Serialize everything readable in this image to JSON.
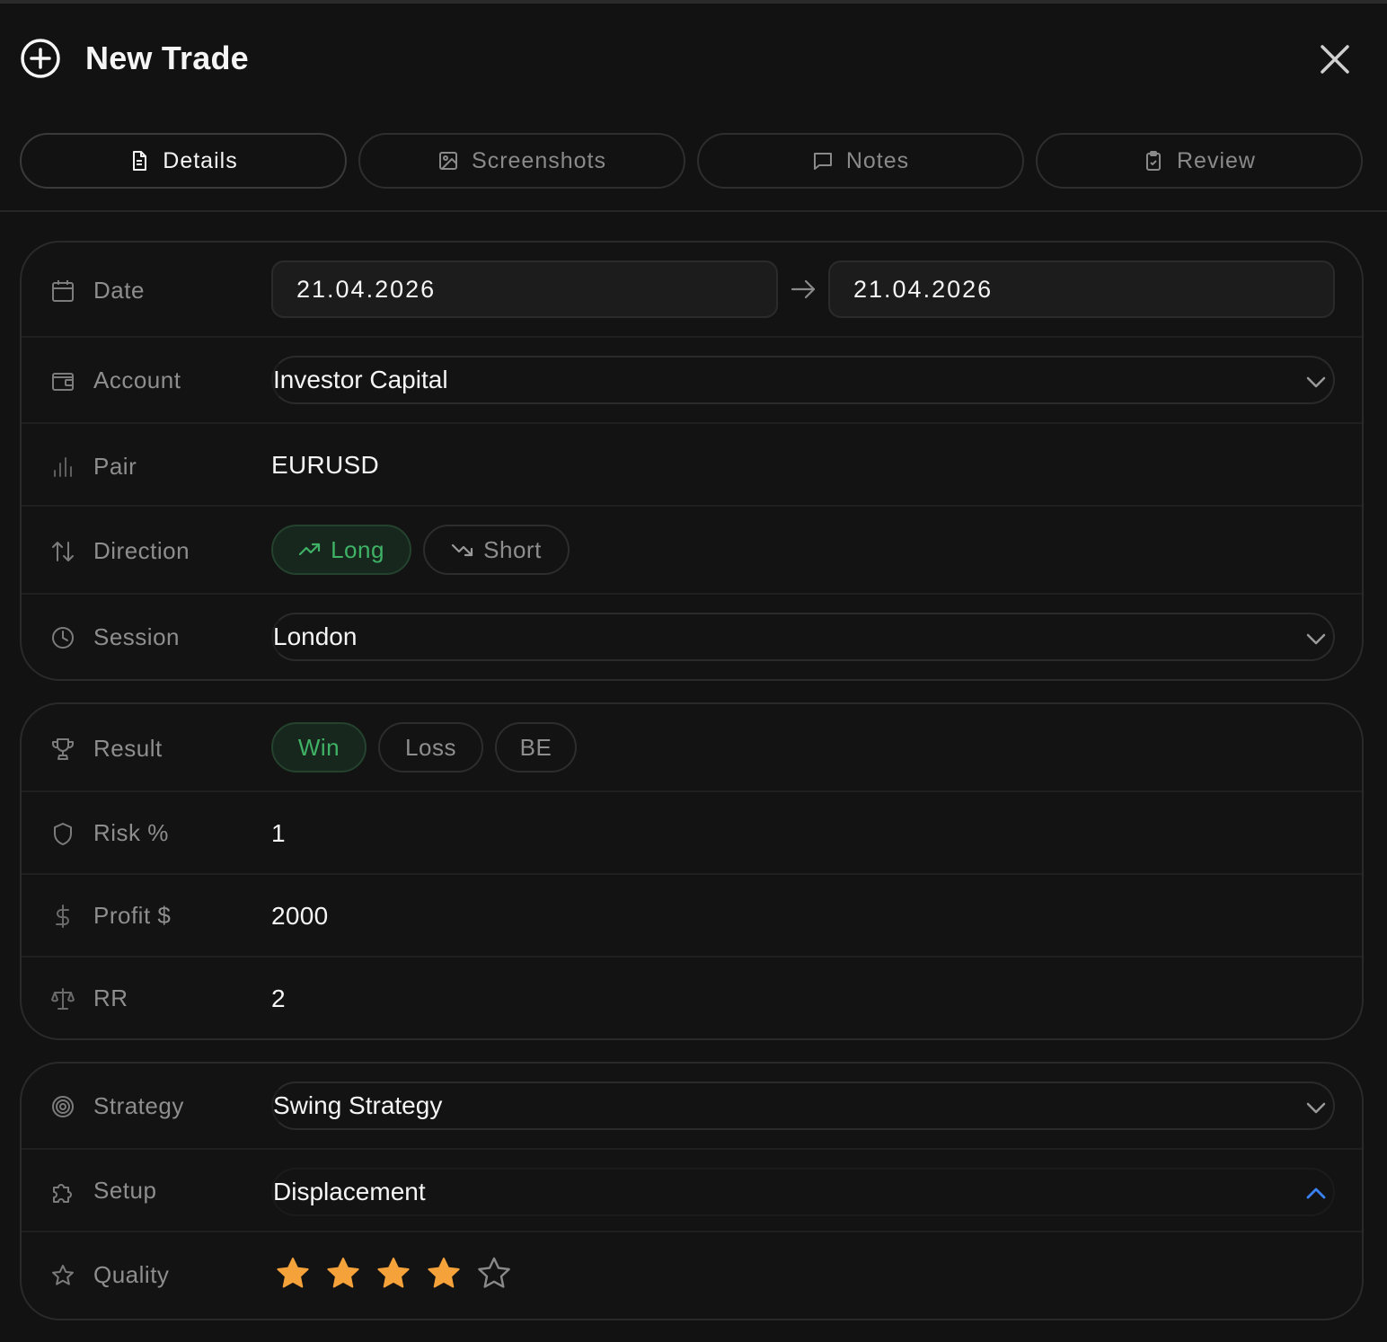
{
  "header": {
    "title": "New Trade"
  },
  "tabs": [
    {
      "label": "Details",
      "icon": "document-icon",
      "active": true
    },
    {
      "label": "Screenshots",
      "icon": "image-icon",
      "active": false
    },
    {
      "label": "Notes",
      "icon": "message-icon",
      "active": false
    },
    {
      "label": "Review",
      "icon": "clipboard-check-icon",
      "active": false
    }
  ],
  "fields": {
    "date": {
      "label": "Date",
      "start": "21.04.2026",
      "end": "21.04.2026"
    },
    "account": {
      "label": "Account",
      "value": "Investor Capital"
    },
    "pair": {
      "label": "Pair",
      "value": "EURUSD"
    },
    "direction": {
      "label": "Direction",
      "options": [
        "Long",
        "Short"
      ],
      "selected": "Long"
    },
    "session": {
      "label": "Session",
      "value": "London"
    },
    "result": {
      "label": "Result",
      "options": [
        "Win",
        "Loss",
        "BE"
      ],
      "selected": "Win"
    },
    "risk": {
      "label": "Risk %",
      "value": "1"
    },
    "profit": {
      "label": "Profit $",
      "value": "2000"
    },
    "rr": {
      "label": "RR",
      "value": "2"
    },
    "strategy": {
      "label": "Strategy",
      "value": "Swing Strategy"
    },
    "setup": {
      "label": "Setup",
      "value": "Displacement"
    },
    "quality": {
      "label": "Quality",
      "rating": 4,
      "max": 5
    }
  },
  "colors": {
    "accent_green": "#3fb266",
    "star_fill": "#f5a23a",
    "open_chevron": "#3b82f6"
  }
}
